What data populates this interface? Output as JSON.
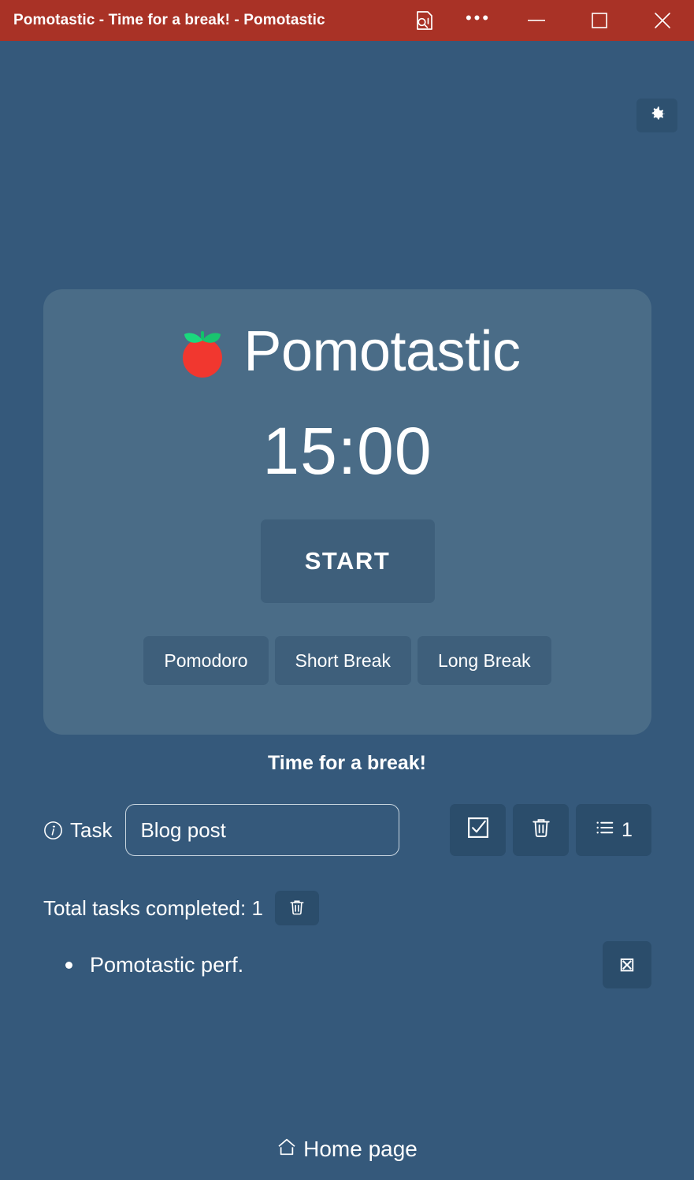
{
  "window": {
    "title": "Pomotastic - Time for a break! - Pomotastic",
    "accent_color": "#A93226",
    "page_background": "#35597B",
    "card_background": "#4A6C87",
    "button_background": "#3E5F7B",
    "icon_button_background": "#2B4D6B",
    "controls": {
      "reading_view_label": "reading-view",
      "more_label": "•••",
      "minimize_label": "Minimize",
      "maximize_label": "Maximize",
      "close_label": "Close"
    }
  },
  "toolbar": {
    "settings_label": "Settings"
  },
  "card": {
    "brand_name": "Pomotastic",
    "timer": "15:00",
    "start_label": "START",
    "modes": [
      {
        "label": "Pomodoro",
        "active": false
      },
      {
        "label": "Short Break",
        "active": false
      },
      {
        "label": "Long Break",
        "active": false
      }
    ]
  },
  "status": {
    "message": "Time for a break!"
  },
  "task": {
    "label": "Task",
    "value": "Blog post",
    "placeholder": "Task",
    "complete_label": "Complete task",
    "delete_label": "Delete task",
    "count_label": "1"
  },
  "completed": {
    "summary": "Total tasks completed: 1",
    "clear_label": "Clear completed",
    "items": [
      {
        "text": "Pomotastic perf.",
        "remove_label": "⊠"
      }
    ]
  },
  "footer": {
    "home_label": "Home page"
  }
}
